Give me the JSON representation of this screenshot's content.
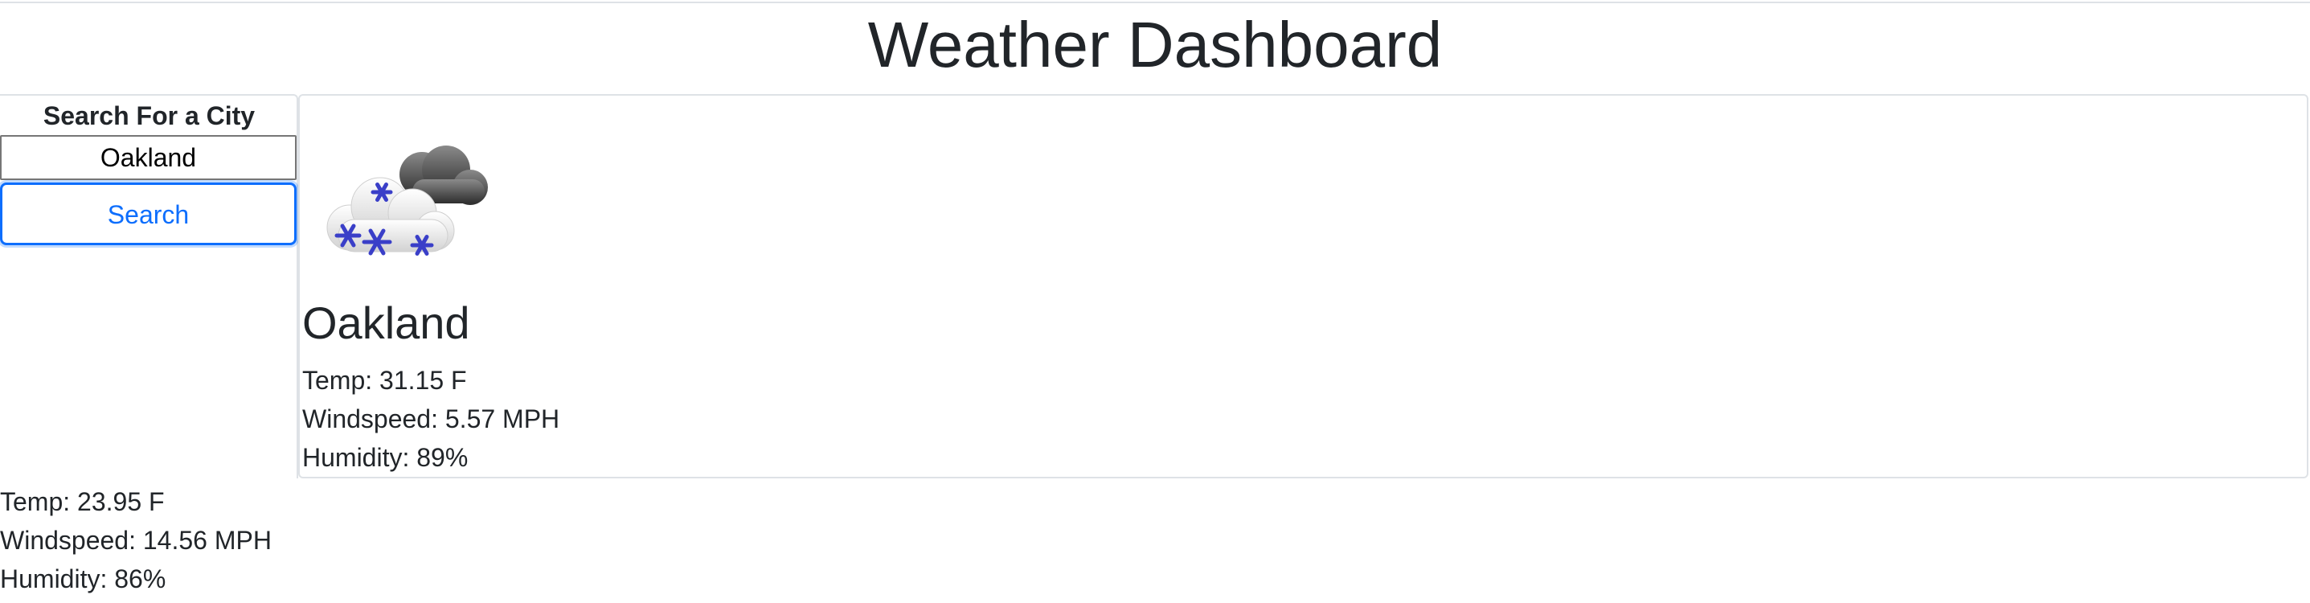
{
  "header": {
    "title": "Weather Dashboard"
  },
  "search": {
    "heading": "Search For a City",
    "input_value": "Oakland",
    "button_label": "Search"
  },
  "current": {
    "icon": "snow-cloud-icon",
    "city": "Oakland",
    "temp": "Temp: 31.15 F",
    "windspeed": "Windspeed: 5.57 MPH",
    "humidity": "Humidity: 89%"
  },
  "forecast": {
    "temp": "Temp: 23.95 F",
    "windspeed": "Windspeed: 14.56 MPH",
    "humidity": "Humidity: 86%"
  },
  "colors": {
    "primary": "#0d6efd",
    "text": "#212529",
    "border": "#dee2e6"
  }
}
